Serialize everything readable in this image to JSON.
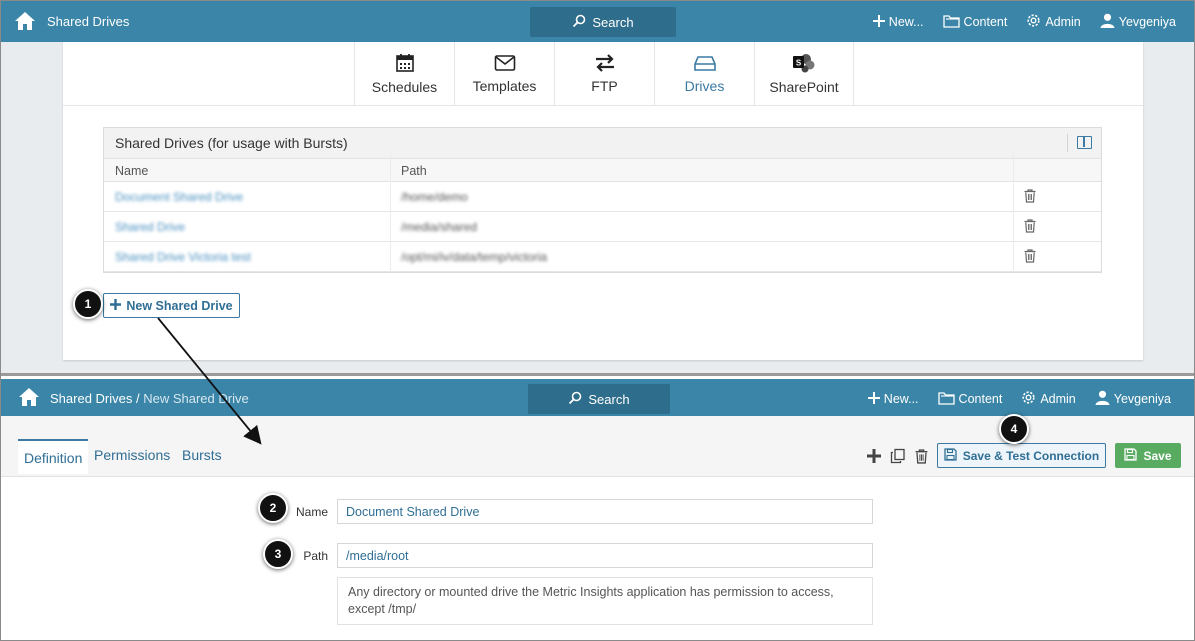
{
  "top_nav": {
    "title": "Shared Drives",
    "search_label": "Search",
    "new_label": "New...",
    "content_label": "Content",
    "admin_label": "Admin",
    "user_label": "Yevgeniya"
  },
  "category_tabs": [
    {
      "label": "Schedules",
      "icon": "calendar-icon"
    },
    {
      "label": "Templates",
      "icon": "envelope-icon"
    },
    {
      "label": "FTP",
      "icon": "transfer-arrows-icon"
    },
    {
      "label": "Drives",
      "icon": "drive-icon",
      "active": true
    },
    {
      "label": "SharePoint",
      "icon": "sharepoint-icon"
    }
  ],
  "drives_grid": {
    "title": "Shared Drives (for usage with Bursts)",
    "columns": [
      "Name",
      "Path"
    ],
    "rows": [
      {
        "name": "Document Shared Drive",
        "path": "/home/demo"
      },
      {
        "name": "Shared Drive",
        "path": "/media/shared"
      },
      {
        "name": "Shared Drive Victoria test",
        "path": "/opt/mi/iv/data/temp/victoria"
      }
    ]
  },
  "new_drive_button": "New Shared Drive",
  "bottom_nav": {
    "crumb_parent": "Shared Drives",
    "crumb_separator": " / ",
    "crumb_current": "New Shared Drive",
    "search_label": "Search",
    "new_label": "New...",
    "content_label": "Content",
    "admin_label": "Admin",
    "user_label": "Yevgeniya"
  },
  "editor_tabs": [
    "Definition",
    "Permissions",
    "Bursts"
  ],
  "actions": {
    "save_test_label": "Save & Test Connection",
    "save_label": "Save"
  },
  "form": {
    "name_label": "Name",
    "name_value": "Document Shared Drive",
    "path_label": "Path",
    "path_value": "/media/root",
    "path_hint": "Any directory or mounted drive the Metric Insights application has permission to access, except /tmp/"
  },
  "callouts": [
    "1",
    "2",
    "3",
    "4"
  ],
  "colors": {
    "nav_bg": "#3a85a8",
    "search_bg": "#2e6d8b",
    "accent": "#3a7aa3",
    "save_green": "#5aab62"
  }
}
